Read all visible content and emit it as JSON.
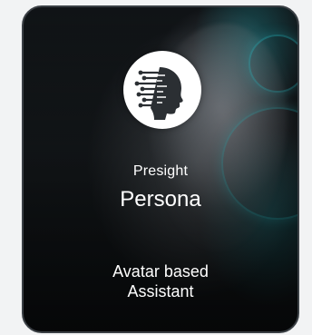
{
  "card": {
    "brand": "Presight",
    "title": "Persona",
    "description_line1": "Avatar based",
    "description_line2": "Assistant",
    "logo_icon": "ai-head-circuit-icon"
  },
  "colors": {
    "page_background": "#f2f3f4",
    "card_border": "#3a3f44",
    "accent_cyan": "#28d2dc",
    "text": "#ffffff"
  }
}
